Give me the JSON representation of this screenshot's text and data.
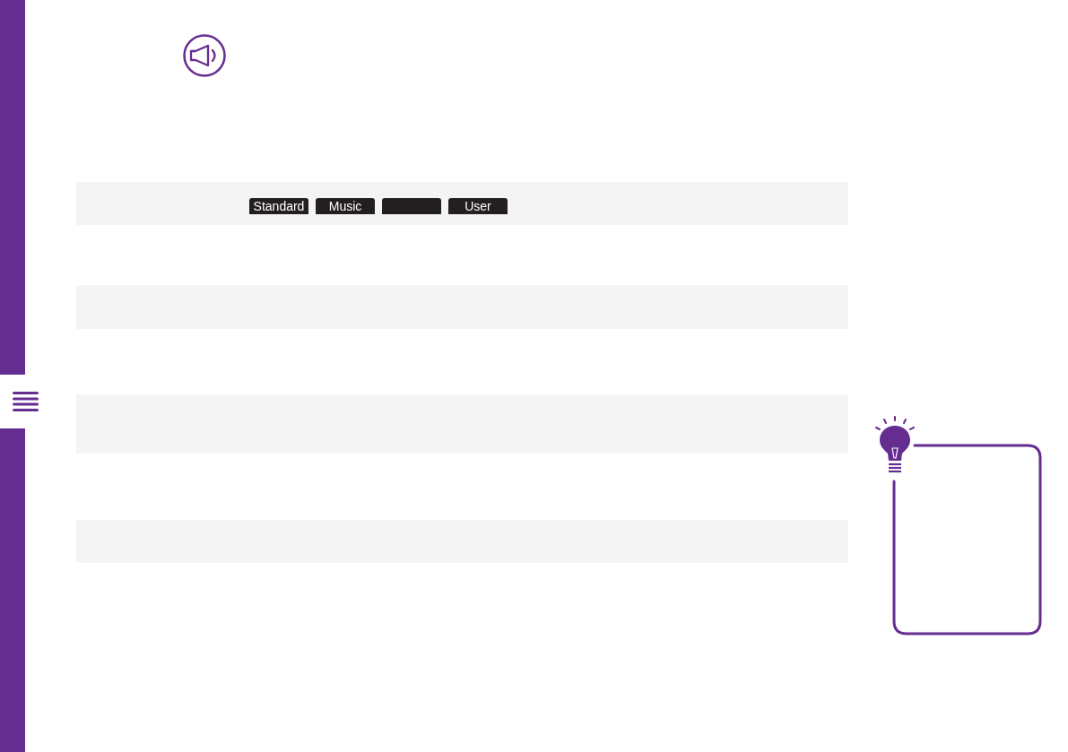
{
  "settings_rows": [
    {
      "kind": "mode-buttons",
      "buttons": [
        {
          "kind": "labeled",
          "label": "Standard"
        },
        {
          "kind": "labeled",
          "label": "Music"
        },
        {
          "kind": "blank"
        },
        {
          "kind": "labeled",
          "label": "User"
        }
      ]
    },
    {
      "kind": "blank"
    },
    {
      "kind": "blank"
    },
    {
      "kind": "blank"
    }
  ]
}
